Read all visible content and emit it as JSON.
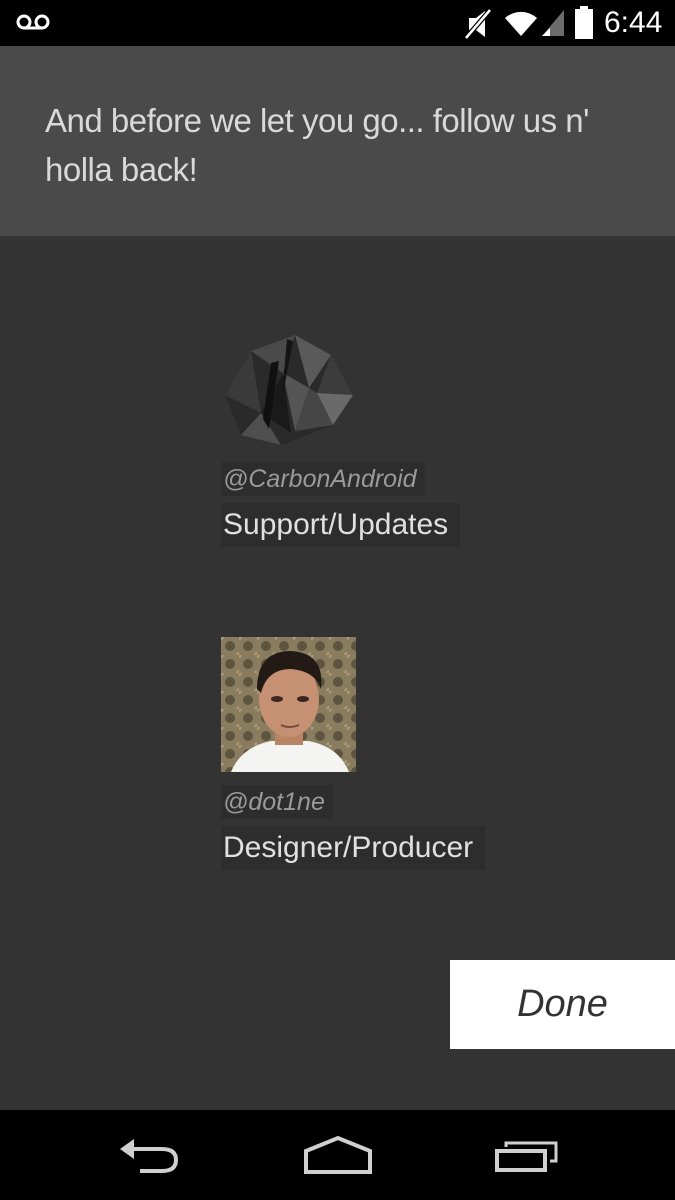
{
  "status_bar": {
    "time": "6:44",
    "icons": [
      "voicemail-icon",
      "mute-icon",
      "wifi-icon",
      "signal-icon",
      "battery-icon"
    ]
  },
  "header": {
    "message": "And before we let you go... follow us n' holla back!"
  },
  "contacts": [
    {
      "handle": "@CarbonAndroid",
      "role": "Support/Updates",
      "icon": "carbon-logo-icon"
    },
    {
      "handle": "@dot1ne",
      "role": "Designer/Producer",
      "icon": "avatar-photo"
    }
  ],
  "done_button": {
    "label": "Done"
  },
  "nav_bar": {
    "icons": [
      "back-icon",
      "home-icon",
      "recent-apps-icon"
    ]
  },
  "colors": {
    "background": "#333333",
    "header": "#4a4a4a",
    "label_bg": "#2d2d2d",
    "button": "#ffffff"
  }
}
